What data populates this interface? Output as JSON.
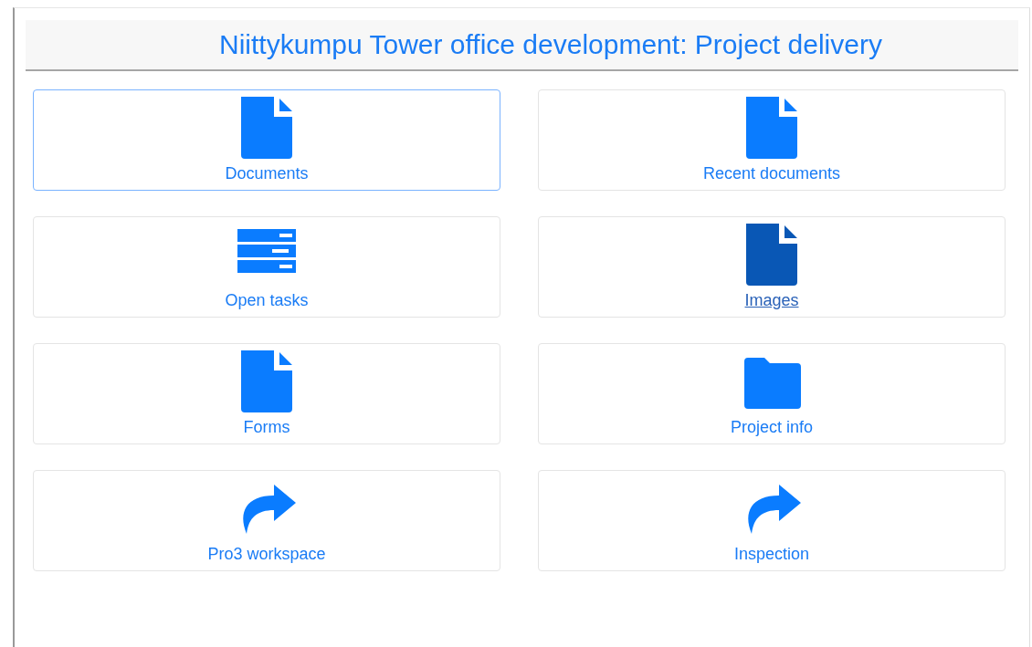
{
  "header": {
    "title": "Niittykumpu Tower office development: Project delivery"
  },
  "tiles": [
    {
      "label": "Documents",
      "kind": "file",
      "focused": true,
      "hovered": false
    },
    {
      "label": "Recent documents",
      "kind": "file",
      "focused": false,
      "hovered": false
    },
    {
      "label": "Open tasks",
      "kind": "list",
      "focused": false,
      "hovered": false
    },
    {
      "label": "Images",
      "kind": "file",
      "focused": false,
      "hovered": true
    },
    {
      "label": "Forms",
      "kind": "file",
      "focused": false,
      "hovered": false
    },
    {
      "label": "Project info",
      "kind": "folder",
      "focused": false,
      "hovered": false
    },
    {
      "label": "Pro3 workspace",
      "kind": "share",
      "focused": false,
      "hovered": false
    },
    {
      "label": "Inspection",
      "kind": "share",
      "focused": false,
      "hovered": false
    }
  ]
}
